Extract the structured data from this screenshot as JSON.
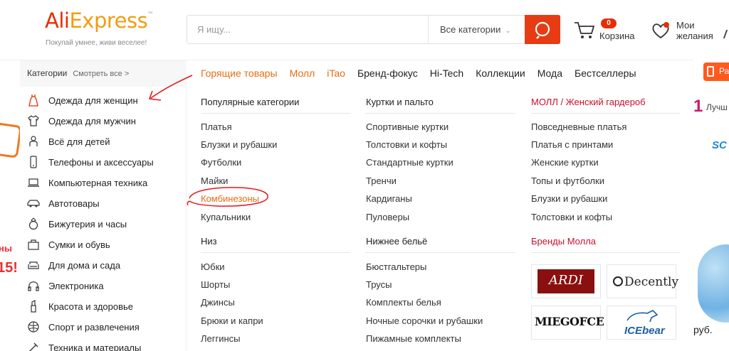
{
  "header": {
    "logo_ali": "Ali",
    "logo_express": "Express",
    "logo_tm": "™",
    "tagline": "Покупай умнее, живи веселее!",
    "search_placeholder": "Я ищу...",
    "category_select": "Все категории",
    "cart_count": "0",
    "cart_label": "Корзина",
    "wishlist_label_1": "Мои",
    "wishlist_label_2": "желания"
  },
  "nav": {
    "categories_label": "Категории",
    "see_all": "Смотреть все >",
    "items": [
      "Горящие товары",
      "Молл",
      "iTao",
      "Бренд-фокус",
      "Hi-Tech",
      "Коллекции",
      "Мода",
      "Бестселлеры"
    ]
  },
  "categories": [
    {
      "label": "Одежда для женщин",
      "icon": "dress-icon"
    },
    {
      "label": "Одежда для мужчин",
      "icon": "tshirt-icon"
    },
    {
      "label": "Всё для детей",
      "icon": "baby-icon"
    },
    {
      "label": "Телефоны и аксессуары",
      "icon": "phone-icon"
    },
    {
      "label": "Компьютерная техника",
      "icon": "laptop-icon"
    },
    {
      "label": "Автотовары",
      "icon": "car-icon"
    },
    {
      "label": "Бижутерия и часы",
      "icon": "ring-icon"
    },
    {
      "label": "Сумки и обувь",
      "icon": "bag-icon"
    },
    {
      "label": "Для дома и сада",
      "icon": "sofa-icon"
    },
    {
      "label": "Электроника",
      "icon": "headphones-icon"
    },
    {
      "label": "Красота и здоровье",
      "icon": "lipstick-icon"
    },
    {
      "label": "Спорт и развлечения",
      "icon": "ball-icon"
    },
    {
      "label": "Техника и материалы",
      "icon": "tools-icon"
    }
  ],
  "mega": {
    "col1": {
      "heading1": "Популярные категории",
      "links1": [
        "Платья",
        "Блузки и рубашки",
        "Футболки",
        "Майки",
        "Комбинезоны",
        "Купальники"
      ],
      "heading2": "Низ",
      "links2": [
        "Юбки",
        "Шорты",
        "Джинсы",
        "Брюки и капри",
        "Леггинсы"
      ]
    },
    "col2": {
      "heading1": "Куртки и пальто",
      "links1": [
        "Спортивные куртки",
        "Толстовки и кофты",
        "Стандартные куртки",
        "Тренчи",
        "Кардиганы",
        "Пуловеры"
      ],
      "heading2": "Нижнее бельё",
      "links2": [
        "Бюстгальтеры",
        "Трусы",
        "Комплекты белья",
        "Ночные сорочки и рубашки",
        "Пижамные комплекты"
      ]
    },
    "col3": {
      "heading1": "МОЛЛ / Женский гардероб",
      "links1": [
        "Повседневные платья",
        "Платья с принтами",
        "Женские куртки",
        "Топы и футболки",
        "Блузки и рубашки",
        "Толстовки и кофты"
      ],
      "heading2": "Бренды Молла",
      "brands": [
        "ARDI",
        "Decently",
        "MIEGOFCE",
        "ICEbear"
      ]
    }
  },
  "right_partial": {
    "pill": "Ра",
    "num": "1",
    "text": "Лучш",
    "sc": "SC",
    "rub": "руб."
  },
  "left_partial": {
    "t1": "ны",
    "t2": "15!"
  },
  "colors": {
    "brand_red": "#e62e04",
    "accent_orange": "#e66d12",
    "mall_red": "#c8102e",
    "annotation_red": "#e8161a"
  }
}
